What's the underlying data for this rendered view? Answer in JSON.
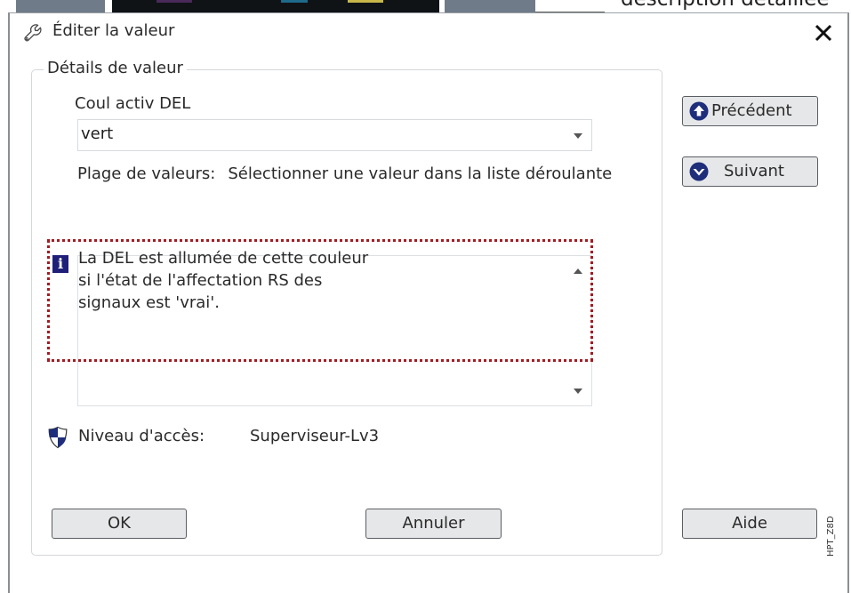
{
  "background": {
    "partial_text": "description détaillée"
  },
  "dialog": {
    "title": "Éditer la valeur",
    "close_symbol": "✕"
  },
  "details": {
    "group_title": "Détails de valeur",
    "field_label": "Coul activ DEL",
    "selected_value": "vert",
    "range_label": "Plage de valeurs:",
    "range_value": "Sélectionner une valeur dans la liste déroulante",
    "description_lines": [
      "La DEL est allumée de cette couleur",
      "si l'état de l'affectation RS des",
      "signaux est 'vrai'."
    ],
    "access_label": "Niveau d'accès:",
    "access_value": "Superviseur-Lv3"
  },
  "buttons": {
    "previous": "Précédent",
    "next": "Suivant",
    "ok": "OK",
    "cancel": "Annuler",
    "help": "Aide"
  },
  "watermark": "HPT_Z8D",
  "colors": {
    "highlight": "#a31b22",
    "info_icon": "#1f1f7a",
    "button_face": "#e6e7e8",
    "shield_blue": "#1e2e7a"
  },
  "icons": [
    "wrench-icon",
    "close-icon",
    "info-icon",
    "shield-icon",
    "arrow-up-circle-icon",
    "arrow-down-circle-icon",
    "chevron-down-icon",
    "chevron-up-icon"
  ]
}
